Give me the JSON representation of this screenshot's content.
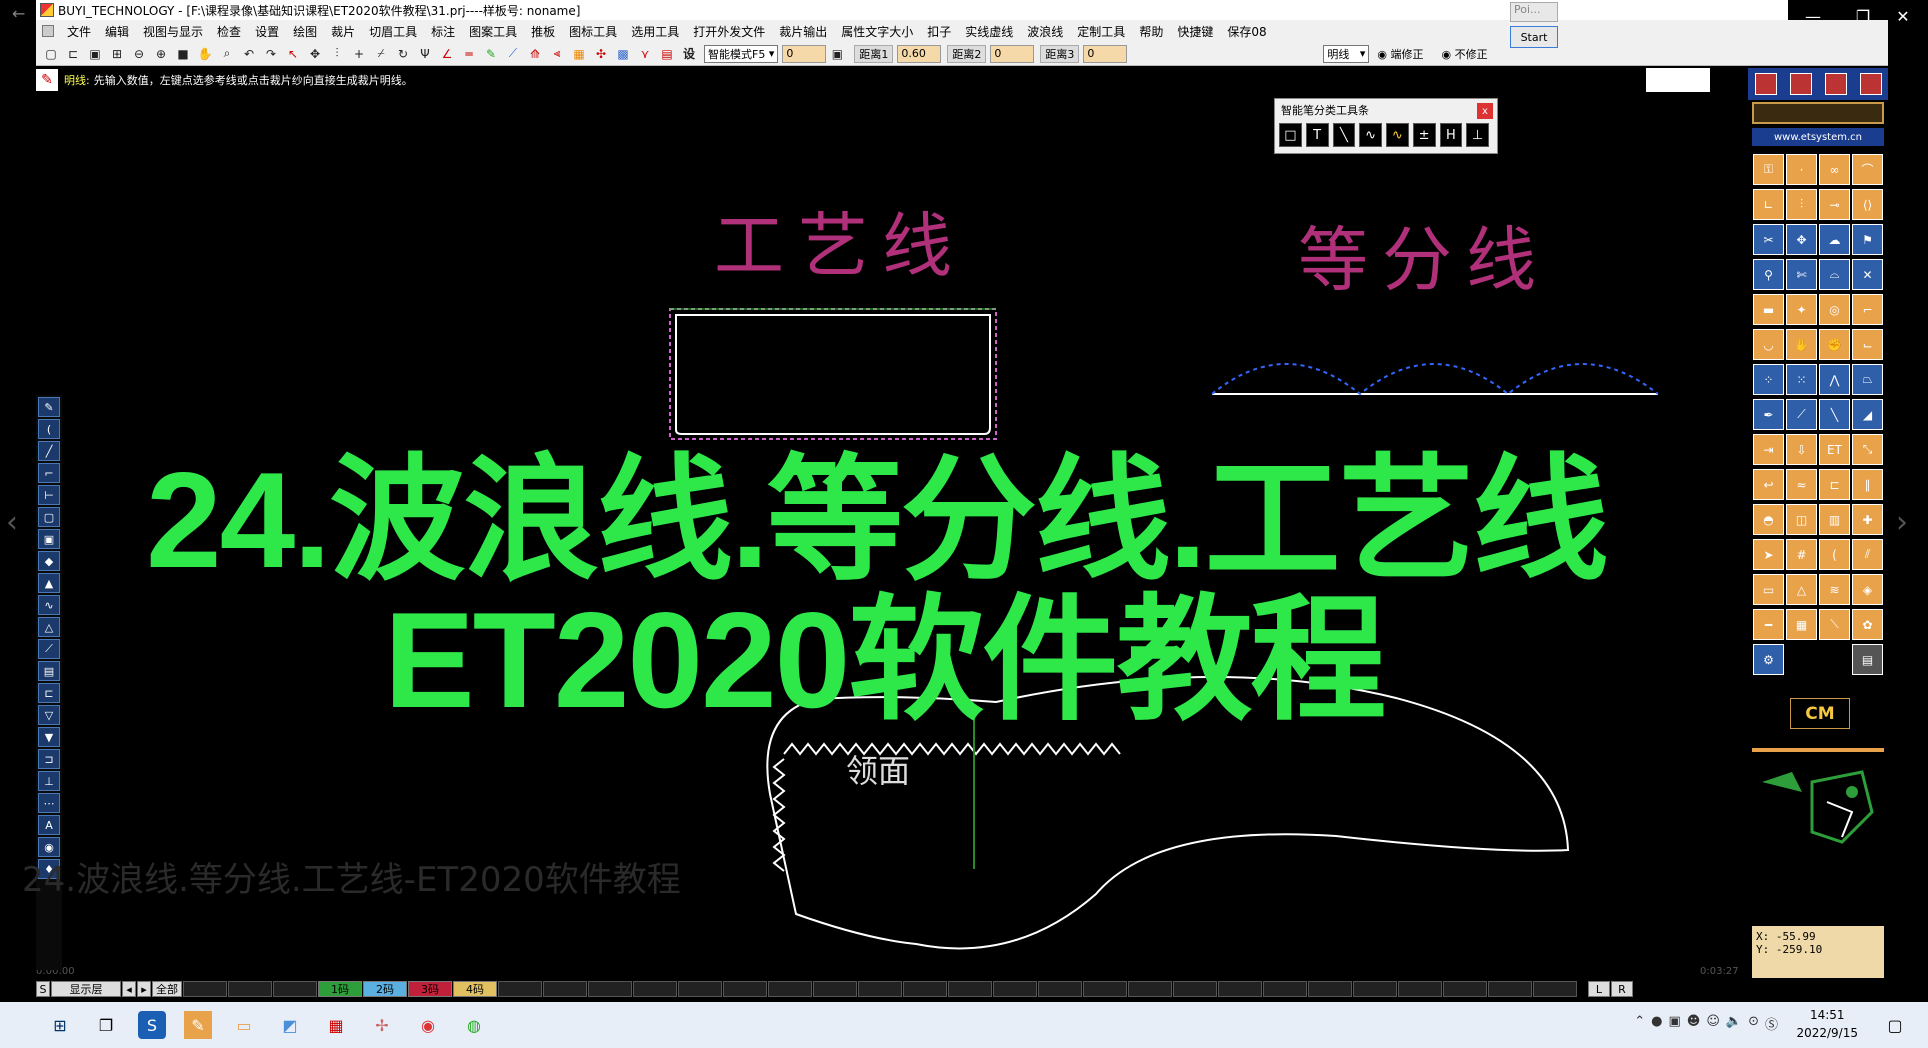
{
  "window": {
    "title": "BUYI_TECHNOLOGY - [F:\\课程录像\\基础知识课程\\ET2020软件教程\\31.prj----样板号: noname]",
    "controls": [
      "—",
      "❐",
      "✕"
    ]
  },
  "menu": {
    "items": [
      "文件",
      "编辑",
      "视图与显示",
      "检查",
      "设置",
      "绘图",
      "裁片",
      "切眉工具",
      "标注",
      "图案工具",
      "推板",
      "图标工具",
      "选用工具",
      "打开外发文件",
      "裁片输出",
      "属性文字大小",
      "扣子",
      "实线虚线",
      "波浪线",
      "定制工具",
      "帮助",
      "快捷键",
      "保存08"
    ]
  },
  "toolbar": {
    "mode_label": "设",
    "mode_select": "智能模式F5",
    "input1": "0",
    "dist1_label": "距离1",
    "dist1_value": "0.60",
    "dist2_label": "距离2",
    "dist2_value": "0",
    "dist3_label": "距离3",
    "dist3_value": "0",
    "line_select": "明线",
    "radio1": "端修正",
    "radio2": "不修正"
  },
  "popup": {
    "poi_label": "Poi...",
    "start_label": "Start"
  },
  "hint": {
    "key": "明线:",
    "text": "先输入数值，左键点选参考线或点击裁片纱向直接生成裁片明线。"
  },
  "floatbox": {
    "title": "智能笔分类工具条",
    "close": "x",
    "tools": [
      "□",
      "T",
      "╲",
      "∿",
      "∿",
      "±",
      "H",
      "⊥"
    ]
  },
  "canvas": {
    "label_craft": "工艺线",
    "label_equal": "等分线",
    "label_collar": "领面"
  },
  "overlay": {
    "title_line1": "24.波浪线.等分线.工艺线",
    "title_line2": "ET2020软件教程",
    "watermark": "24.波浪线.等分线.工艺线-ET2020软件教程",
    "time_left": "0:00:00",
    "time_right": "0:03:27"
  },
  "right_panel": {
    "url": "www.etsystem.cn",
    "cm_label": "CM",
    "coord_x": "X:   -55.99",
    "coord_y": "Y:  -259.10"
  },
  "layers": {
    "s_label": "S",
    "display_label": "显示层",
    "all_label": "全部",
    "codes": [
      {
        "label": "1码",
        "color": "#2e9e3a"
      },
      {
        "label": "2码",
        "color": "#5ab0e0"
      },
      {
        "label": "3码",
        "color": "#c0203a"
      },
      {
        "label": "4码",
        "color": "#e0c060"
      }
    ],
    "right_l": "L",
    "right_r": "R"
  },
  "taskbar": {
    "time": "14:51",
    "date": "2022/9/15"
  },
  "colors": {
    "title_green": "#2ee84a",
    "magenta_text": "#b0307a",
    "panel_orange": "#e8a24a",
    "toolbar_input": "#f6d9a8"
  }
}
